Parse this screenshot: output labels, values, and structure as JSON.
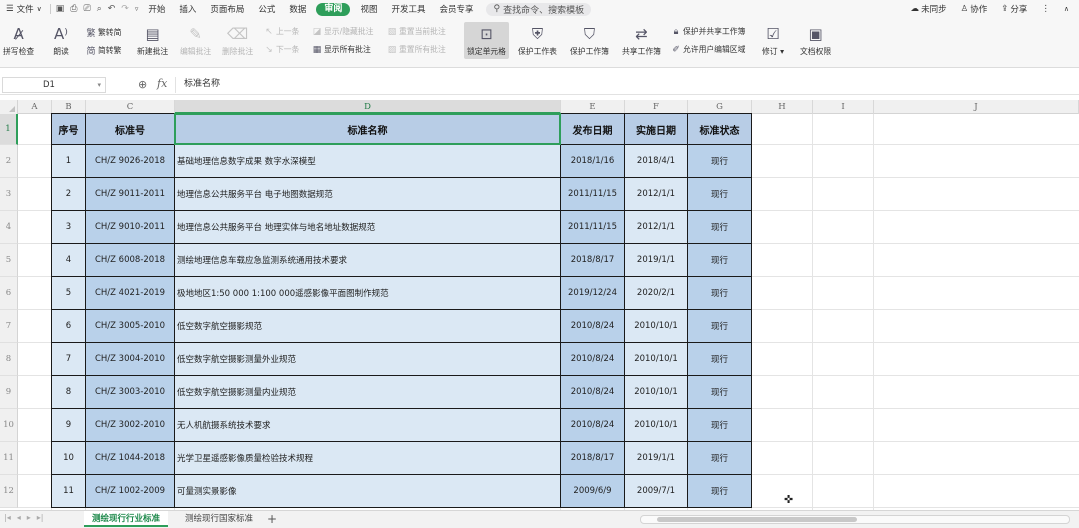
{
  "menubar": {
    "file_label": "文件",
    "tabs": [
      "开始",
      "插入",
      "页面布局",
      "公式",
      "数据",
      "审阅",
      "视图",
      "开发工具",
      "会员专享"
    ],
    "active_tab": "审阅",
    "search_placeholder": "查找命令、搜索模板",
    "sync_label": "未同步",
    "collab_label": "协作",
    "share_label": "分享"
  },
  "ribbon": {
    "spellcheck": "拼写检查",
    "read_aloud": "朗读",
    "to_traditional": "繁转简",
    "to_simplified": "简转繁",
    "new_comment": "新建批注",
    "edit_comment": "编辑批注",
    "delete_comment": "删除批注",
    "prev_comment": "上一条",
    "next_comment": "下一条",
    "show_hide_comment": "显示/隐藏批注",
    "show_all_comments": "显示所有批注",
    "reset_current_comment": "重置当前批注",
    "reset_all_comments": "重置所有批注",
    "lock_cell": "锁定单元格",
    "protect_sheet": "保护工作表",
    "protect_workbook": "保护工作簿",
    "share_workbook": "共享工作簿",
    "protect_and_share": "保护并共享工作簿",
    "allow_user_edit": "允许用户编辑区域",
    "track_changes": "修订",
    "doc_permission": "文档权限"
  },
  "formula_bar": {
    "cell_ref": "D1",
    "content": "标准名称"
  },
  "grid": {
    "columns": [
      "A",
      "B",
      "C",
      "D",
      "E",
      "F",
      "G",
      "H",
      "I",
      "J"
    ],
    "row_numbers": [
      "1",
      "2",
      "3",
      "4",
      "5",
      "6",
      "7",
      "8",
      "9",
      "10",
      "11",
      "12"
    ],
    "headers": [
      "序号",
      "标准号",
      "标准名称",
      "发布日期",
      "实施日期",
      "标准状态"
    ],
    "rows": [
      [
        "1",
        "CH/Z 9026-2018",
        "基础地理信息数字成果 数字水深模型",
        "2018/1/16",
        "2018/4/1",
        "现行"
      ],
      [
        "2",
        "CH/Z 9011-2011",
        "地理信息公共服务平台 电子地图数据规范",
        "2011/11/15",
        "2012/1/1",
        "现行"
      ],
      [
        "3",
        "CH/Z 9010-2011",
        "地理信息公共服务平台 地理实体与地名地址数据规范",
        "2011/11/15",
        "2012/1/1",
        "现行"
      ],
      [
        "4",
        "CH/Z 6008-2018",
        "测绘地理信息车载应急监测系统通用技术要求",
        "2018/8/17",
        "2019/1/1",
        "现行"
      ],
      [
        "5",
        "CH/Z 4021-2019",
        "极地地区1:50 000 1:100 000遥感影像平面图制作规范",
        "2019/12/24",
        "2020/2/1",
        "现行"
      ],
      [
        "6",
        "CH/Z 3005-2010",
        "低空数字航空摄影规范",
        "2010/8/24",
        "2010/10/1",
        "现行"
      ],
      [
        "7",
        "CH/Z 3004-2010",
        "低空数字航空摄影测量外业规范",
        "2010/8/24",
        "2010/10/1",
        "现行"
      ],
      [
        "8",
        "CH/Z 3003-2010",
        "低空数字航空摄影测量内业规范",
        "2010/8/24",
        "2010/10/1",
        "现行"
      ],
      [
        "9",
        "CH/Z 3002-2010",
        "无人机航摄系统技术要求",
        "2010/8/24",
        "2010/10/1",
        "现行"
      ],
      [
        "10",
        "CH/Z 1044-2018",
        "光学卫星遥感影像质量检验技术规程",
        "2018/8/17",
        "2019/1/1",
        "现行"
      ],
      [
        "11",
        "CH/Z 1002-2009",
        "可量测实景影像",
        "2009/6/9",
        "2009/7/1",
        "现行"
      ]
    ]
  },
  "sheets": {
    "tabs": [
      "测绘现行行业标准",
      "测绘现行国家标准"
    ],
    "active": "测绘现行行业标准",
    "add_label": "+"
  },
  "colors": {
    "accent": "#2e9e5a",
    "row_light": "#dbe8f4",
    "row_dark": "#b9d1ea",
    "header_fill": "#b8cde6"
  }
}
